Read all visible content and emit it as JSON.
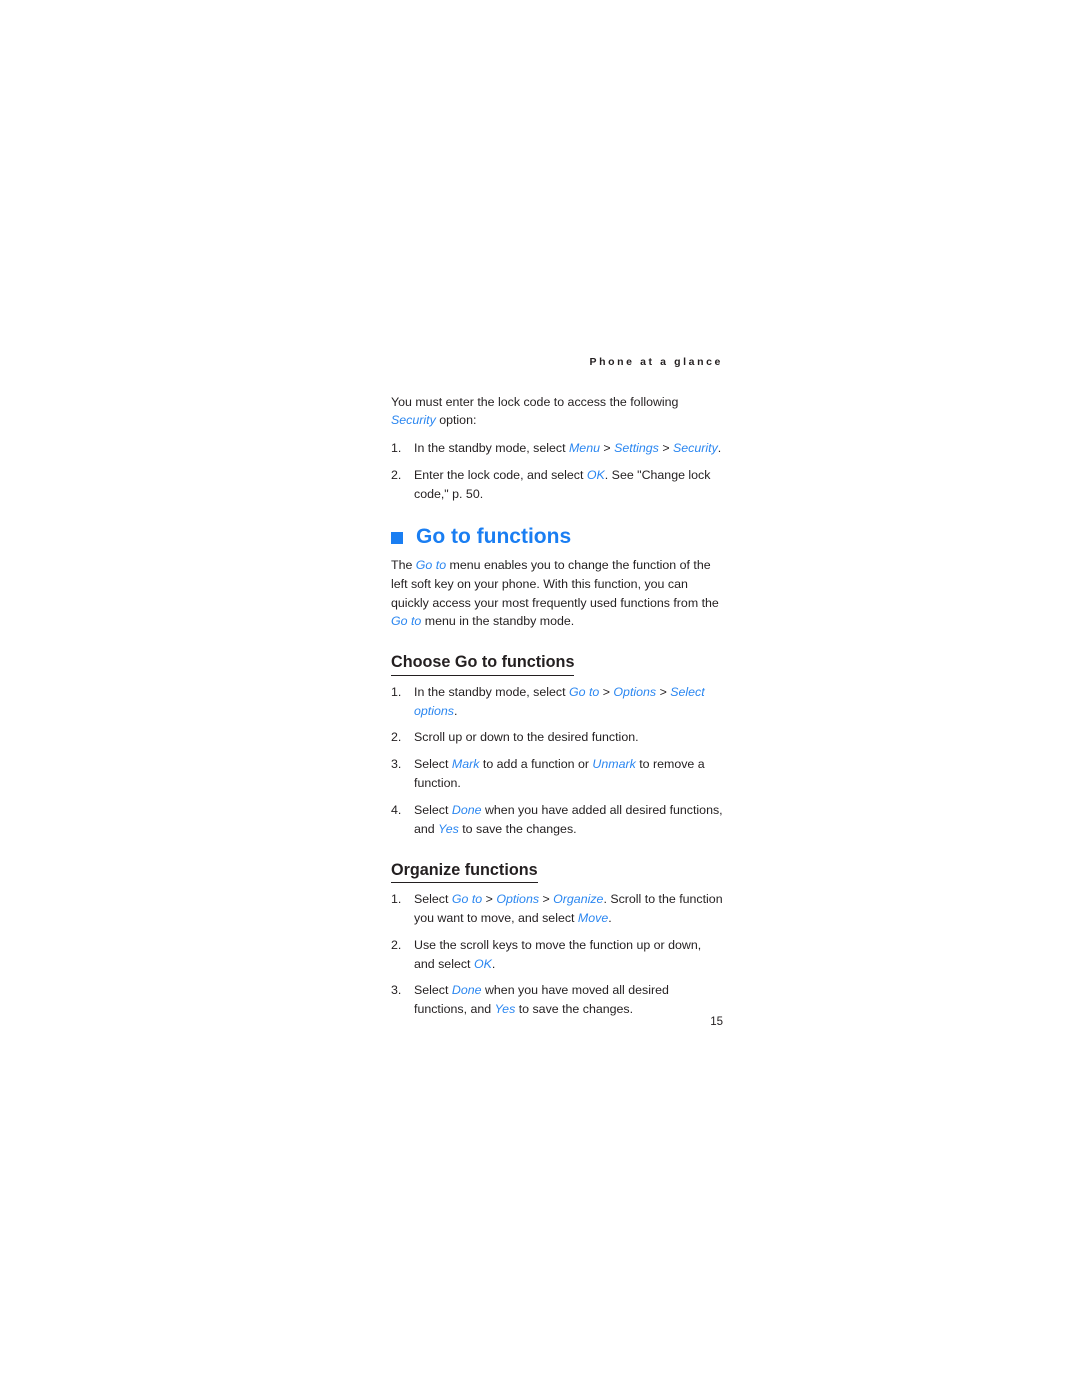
{
  "document": {
    "running_header": "Phone at a glance",
    "page_number": "15",
    "accent_color": "#1a7ef2",
    "ui_term_color": "#2a86f0",
    "text_color": "#231f20"
  },
  "intro": {
    "paragraph_lead": "You must enter the lock code to access the following ",
    "paragraph_term": "Security",
    "paragraph_tail": " option:",
    "steps": [
      {
        "number": "1.",
        "parts": [
          {
            "type": "text",
            "value": "In the standby mode, select "
          },
          {
            "type": "ui",
            "value": "Menu"
          },
          {
            "type": "sep",
            "value": " > "
          },
          {
            "type": "ui",
            "value": "Settings"
          },
          {
            "type": "sep",
            "value": " > "
          },
          {
            "type": "ui",
            "value": "Security"
          },
          {
            "type": "text",
            "value": "."
          }
        ],
        "t1": "In the standby mode, select ",
        "u1": "Menu",
        "s1": " > ",
        "u2": "Settings",
        "s2": " > ",
        "u3": "Security",
        "t2": "."
      },
      {
        "number": "2.",
        "t1": "Enter the lock code, and select ",
        "u1": "OK",
        "t2": ". See \"Change lock code,\" p. 50."
      }
    ]
  },
  "chapter": {
    "bullet": "square-bullet",
    "title": "Go to functions",
    "intro_t1": "The ",
    "intro_u1": "Go to",
    "intro_t2": " menu enables you to change the function of the left soft key on your phone. With this function, you can quickly access your most frequently used functions from the ",
    "intro_u2": "Go to",
    "intro_t3": " menu in the standby mode."
  },
  "choose_section": {
    "heading": "Choose Go to functions",
    "steps": [
      {
        "number": "1.",
        "t1": "In the standby mode, select ",
        "u1": "Go to",
        "s1": " > ",
        "u2": "Options",
        "s2": " > ",
        "u3": "Select options",
        "t2": "."
      },
      {
        "number": "2.",
        "t1": "Scroll up or down to the desired function."
      },
      {
        "number": "3.",
        "t1": "Select ",
        "u1": "Mark",
        "t2": " to add a function or ",
        "u2": "Unmark",
        "t3": " to remove a function."
      },
      {
        "number": "4.",
        "t1": "Select ",
        "u1": "Done",
        "t2": " when you have added all desired functions, and ",
        "u2": "Yes",
        "t3": " to save the changes."
      }
    ]
  },
  "organize_section": {
    "heading": "Organize functions",
    "steps": [
      {
        "number": "1.",
        "t1": "Select ",
        "u1": "Go to",
        "s1": " > ",
        "u2": "Options",
        "s2": " > ",
        "u3": "Organize",
        "t2": ". Scroll to the function you want to move, and select ",
        "u4": "Move",
        "t3": "."
      },
      {
        "number": "2.",
        "t1": "Use the scroll keys to move the function up or down, and select ",
        "u1": "OK",
        "t2": "."
      },
      {
        "number": "3.",
        "t1": "Select ",
        "u1": "Done",
        "t2": " when you have moved all desired functions, and ",
        "u2": "Yes",
        "t3": " to save the changes."
      }
    ]
  }
}
